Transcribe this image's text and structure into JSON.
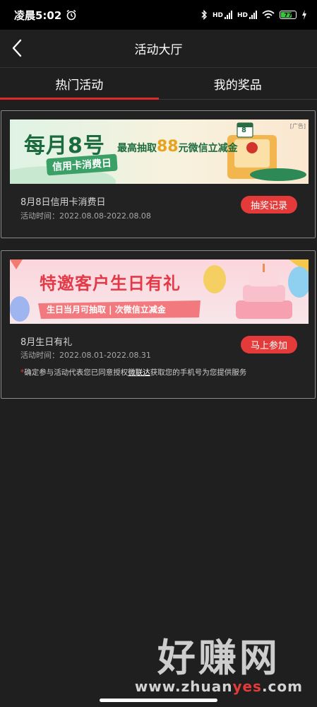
{
  "status_bar": {
    "time": "凌晨5:02",
    "hd1": "HD",
    "hd2": "HD",
    "battery": "77"
  },
  "header": {
    "title": "活动大厅"
  },
  "tabs": [
    {
      "label": "热门活动",
      "active": true
    },
    {
      "label": "我的奖品",
      "active": false
    }
  ],
  "activities": [
    {
      "banner": {
        "headline": "每月8号",
        "sub": "信用卡消费日",
        "promo_prefix": "最高抽取",
        "promo_amount": "88",
        "promo_suffix": "元微信立减金",
        "ad_tag": "[广告]",
        "calendar_number": "8"
      },
      "title": "8月8日信用卡消费日",
      "time_label": "活动时间：",
      "time_range": "2022.08.08-2022.08.08",
      "button_label": "抽奖记录"
    },
    {
      "banner": {
        "headline": "特邀客户生日有礼",
        "sub": "生日当月可抽取 | 次微信立减金"
      },
      "title": "8月生日有礼",
      "time_label": "活动时间：",
      "time_range": "2022.08.01-2022.08.31",
      "button_label": "马上参加",
      "notice": {
        "star": "*",
        "prefix": "确定参与活动代表您已同意授权",
        "link": "微联达",
        "suffix": "获取您的手机号为您提供服务"
      }
    }
  ],
  "watermark": {
    "title": "好赚网",
    "url_prefix": "www.zhuan",
    "url_highlight": "yes",
    "url_suffix": ".com"
  },
  "colors": {
    "accent": "#e43a39",
    "tab_underline": "#e02a2a",
    "background": "#1f1f1f"
  }
}
